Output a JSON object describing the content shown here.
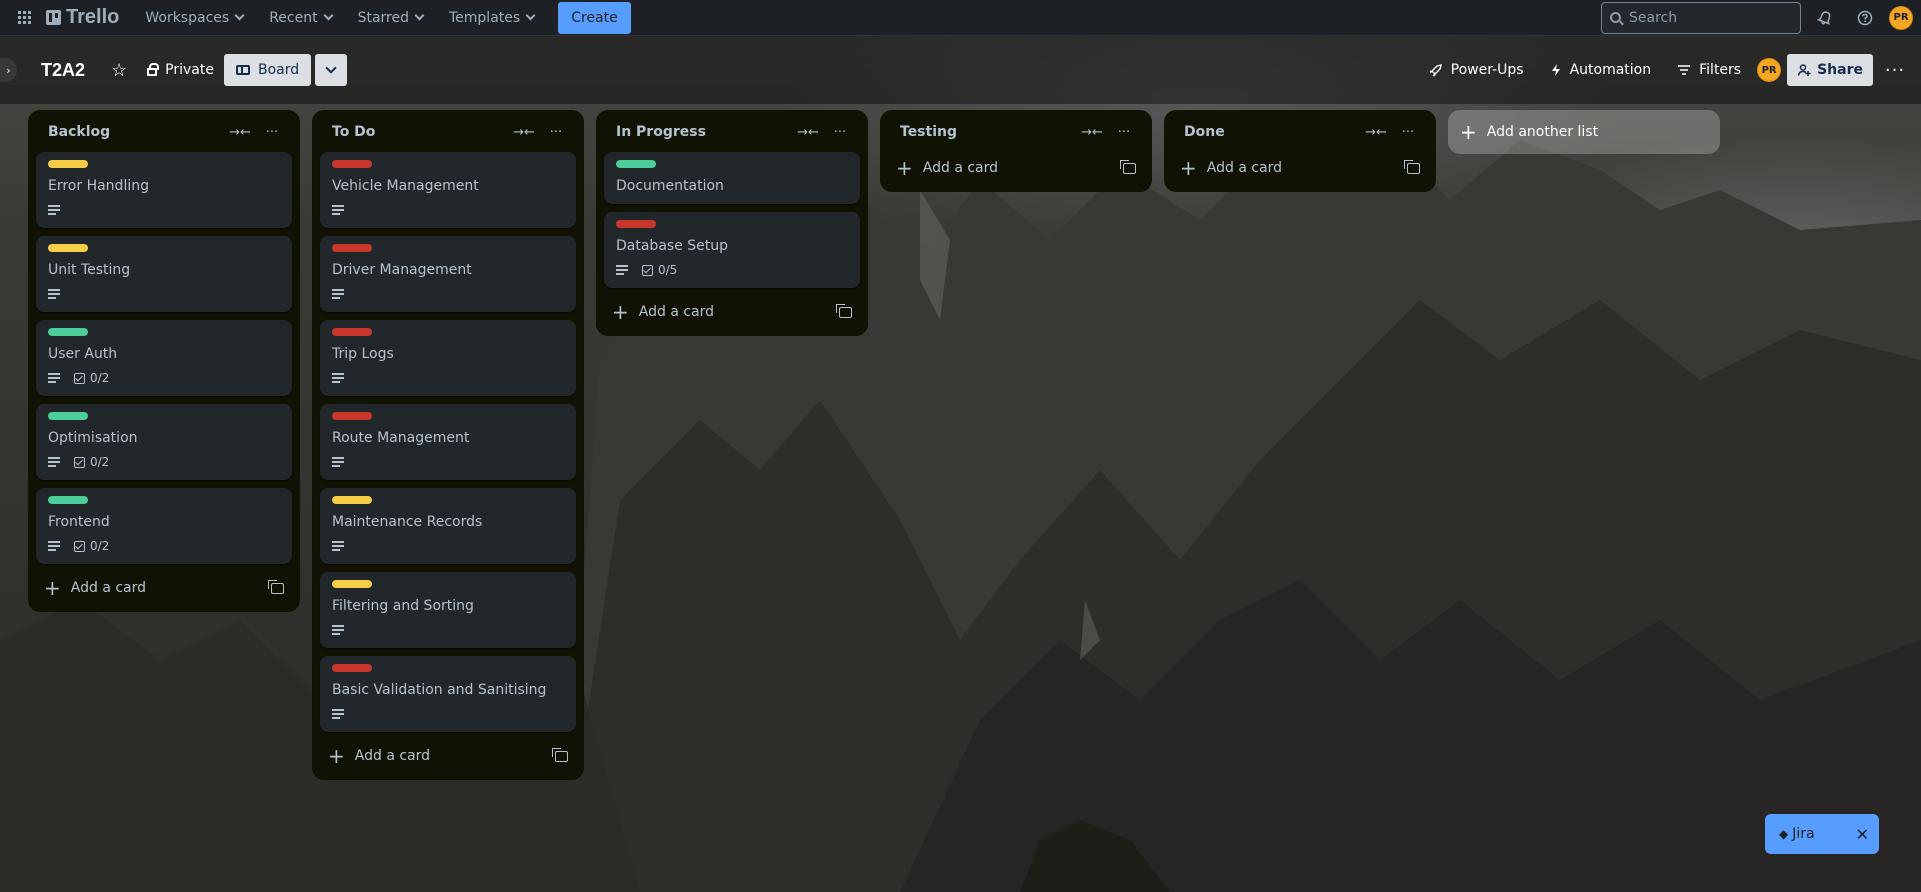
{
  "nav": {
    "logo_text": "Trello",
    "menu": [
      "Workspaces",
      "Recent",
      "Starred",
      "Templates"
    ],
    "create_label": "Create",
    "search_placeholder": "Search",
    "avatar_initials": "PR"
  },
  "board": {
    "title": "T2A2",
    "visibility_label": "Private",
    "view_label": "Board",
    "powerups_label": "Power-Ups",
    "automation_label": "Automation",
    "filters_label": "Filters",
    "share_label": "Share",
    "member_initials": "PR"
  },
  "colors": {
    "yellow": "#F5CD47",
    "red": "#C9372C",
    "green": "#4BCE97"
  },
  "lists": [
    {
      "title": "Backlog",
      "add_label": "Add a card",
      "cards": [
        {
          "title": "Error Handling",
          "label": "yellow",
          "desc": true,
          "checklist": ""
        },
        {
          "title": "Unit Testing",
          "label": "yellow",
          "desc": true,
          "checklist": ""
        },
        {
          "title": "User Auth",
          "label": "green",
          "desc": true,
          "checklist": "0/2"
        },
        {
          "title": "Optimisation",
          "label": "green",
          "desc": true,
          "checklist": "0/2"
        },
        {
          "title": "Frontend",
          "label": "green",
          "desc": true,
          "checklist": "0/2"
        }
      ]
    },
    {
      "title": "To Do",
      "add_label": "Add a card",
      "cards": [
        {
          "title": "Vehicle Management",
          "label": "red",
          "desc": true,
          "checklist": ""
        },
        {
          "title": "Driver Management",
          "label": "red",
          "desc": true,
          "checklist": ""
        },
        {
          "title": "Trip Logs",
          "label": "red",
          "desc": true,
          "checklist": ""
        },
        {
          "title": "Route Management",
          "label": "red",
          "desc": true,
          "checklist": ""
        },
        {
          "title": "Maintenance Records",
          "label": "yellow",
          "desc": true,
          "checklist": ""
        },
        {
          "title": "Filtering and Sorting",
          "label": "yellow",
          "desc": true,
          "checklist": ""
        },
        {
          "title": "Basic Validation and Sanitising",
          "label": "red",
          "desc": true,
          "checklist": ""
        }
      ]
    },
    {
      "title": "In Progress",
      "add_label": "Add a card",
      "cards": [
        {
          "title": "Documentation",
          "label": "green",
          "desc": false,
          "checklist": ""
        },
        {
          "title": "Database Setup",
          "label": "red",
          "desc": true,
          "checklist": "0/5"
        }
      ]
    },
    {
      "title": "Testing",
      "add_label": "Add a card",
      "cards": []
    },
    {
      "title": "Done",
      "add_label": "Add a card",
      "cards": []
    }
  ],
  "add_list_label": "Add another list",
  "jira": {
    "label": "Jira"
  }
}
